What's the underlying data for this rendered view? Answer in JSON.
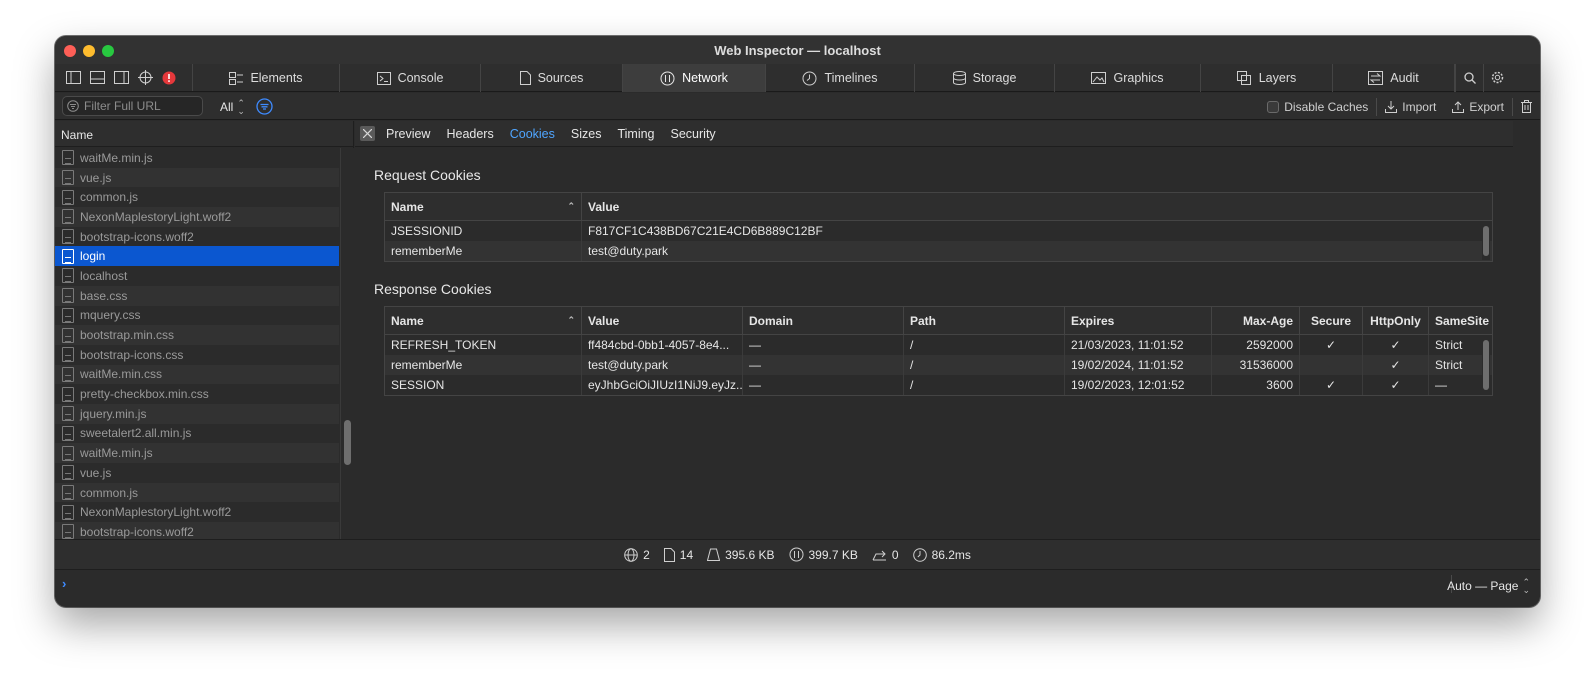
{
  "window": {
    "title": "Web Inspector — localhost"
  },
  "tabs": [
    {
      "label": "Elements",
      "icon": "elements-icon"
    },
    {
      "label": "Console",
      "icon": "console-icon"
    },
    {
      "label": "Sources",
      "icon": "sources-icon"
    },
    {
      "label": "Network",
      "icon": "network-icon",
      "active": true
    },
    {
      "label": "Timelines",
      "icon": "timelines-icon"
    },
    {
      "label": "Storage",
      "icon": "storage-icon"
    },
    {
      "label": "Graphics",
      "icon": "graphics-icon"
    },
    {
      "label": "Layers",
      "icon": "layers-icon"
    },
    {
      "label": "Audit",
      "icon": "audit-icon"
    }
  ],
  "filterbar": {
    "placeholder": "Filter Full URL",
    "type_filter": "All",
    "disable_caches": "Disable Caches",
    "import": "Import",
    "export": "Export"
  },
  "resources": {
    "header": "Name",
    "items": [
      "waitMe.min.js",
      "vue.js",
      "common.js",
      "NexonMaplestoryLight.woff2",
      "bootstrap-icons.woff2",
      "login",
      "localhost",
      "base.css",
      "mquery.css",
      "bootstrap.min.css",
      "bootstrap-icons.css",
      "waitMe.min.css",
      "pretty-checkbox.min.css",
      "jquery.min.js",
      "sweetalert2.all.min.js",
      "waitMe.min.js",
      "vue.js",
      "common.js",
      "NexonMaplestoryLight.woff2",
      "bootstrap-icons.woff2"
    ],
    "selected": "login"
  },
  "detail_tabs": [
    "Preview",
    "Headers",
    "Cookies",
    "Sizes",
    "Timing",
    "Security"
  ],
  "detail_active_tab": "Cookies",
  "request_cookies": {
    "title": "Request Cookies",
    "columns": [
      "Name",
      "Value"
    ],
    "rows": [
      [
        "JSESSIONID",
        "F817CF1C438BD67C21E4CD6B889C12BF"
      ],
      [
        "rememberMe",
        "test@duty.park"
      ]
    ]
  },
  "response_cookies": {
    "title": "Response Cookies",
    "columns": [
      "Name",
      "Value",
      "Domain",
      "Path",
      "Expires",
      "Max-Age",
      "Secure",
      "HttpOnly",
      "SameSite"
    ],
    "rows": [
      [
        "REFRESH_TOKEN",
        "ff484cbd-0bb1-4057-8e4...",
        "—",
        "/",
        "21/03/2023, 11:01:52",
        "2592000",
        "✓",
        "✓",
        "Strict"
      ],
      [
        "rememberMe",
        "test@duty.park",
        "—",
        "/",
        "19/02/2024, 11:01:52",
        "31536000",
        "",
        "✓",
        "Strict"
      ],
      [
        "SESSION",
        "eyJhbGciOiJIUzI1NiJ9.eyJz...",
        "—",
        "/",
        "19/02/2023, 12:01:52",
        "3600",
        "✓",
        "✓",
        "—"
      ]
    ]
  },
  "status": {
    "domains": "2",
    "resources": "14",
    "transferred": "395.6 KB",
    "size": "399.7 KB",
    "redirects": "0",
    "time": "86.2ms"
  },
  "console": {
    "auto_page": "Auto — Page"
  }
}
